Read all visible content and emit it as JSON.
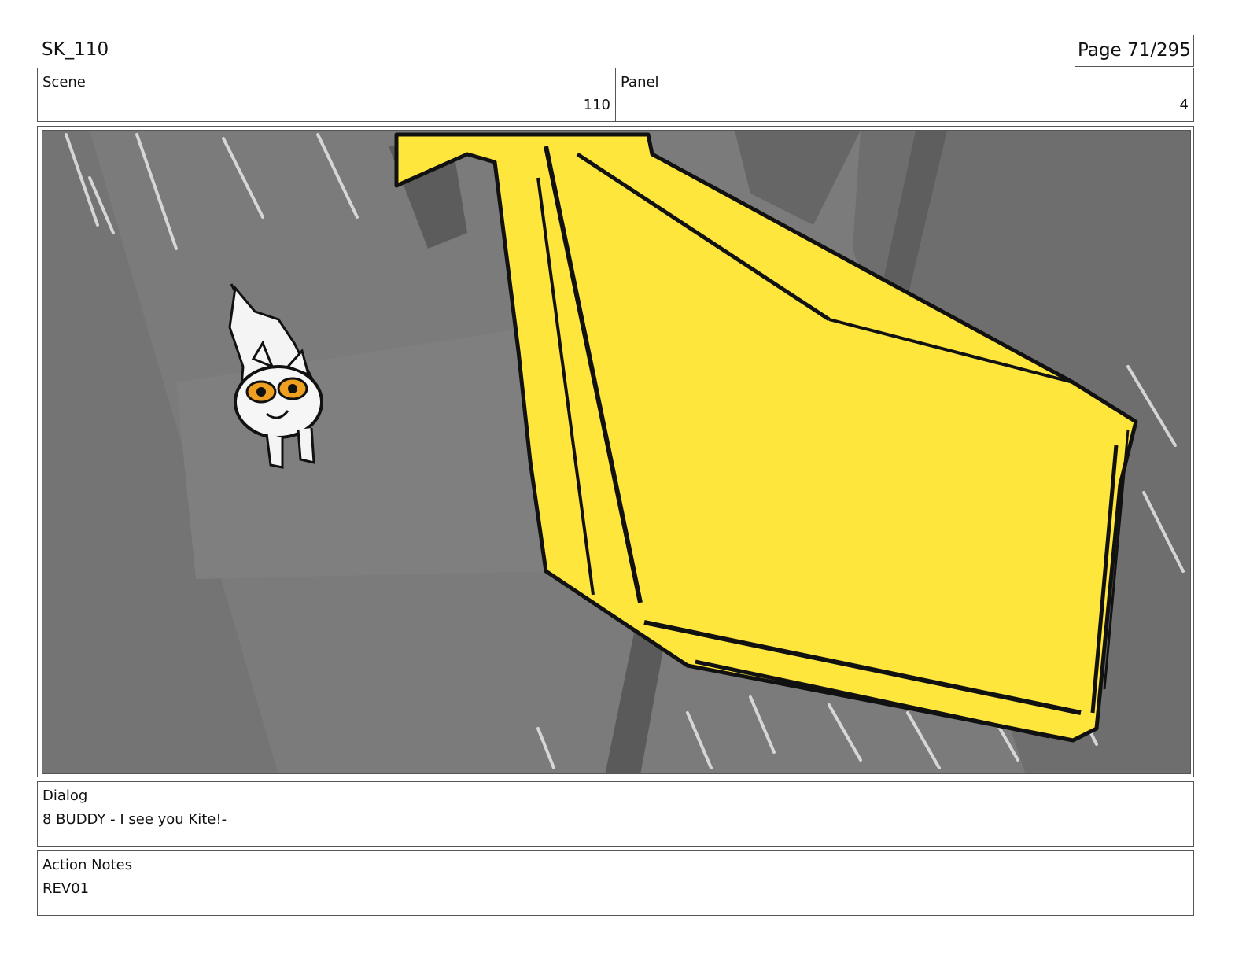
{
  "header": {
    "sheet_title": "SK_110",
    "page_label": "Page 71/295"
  },
  "scene": {
    "label": "Scene",
    "value": "110"
  },
  "panel": {
    "label": "Panel",
    "value": "4"
  },
  "dialog": {
    "label": "Dialog",
    "text": "8 BUDDY - I see you Kite!-"
  },
  "action_notes": {
    "label": "Action Notes",
    "text": "REV01"
  },
  "colors": {
    "background_gray": "#7a7a7a",
    "kite_yellow": "#ffe63c",
    "outline_black": "#111111",
    "eye_orange": "#f0a020"
  }
}
